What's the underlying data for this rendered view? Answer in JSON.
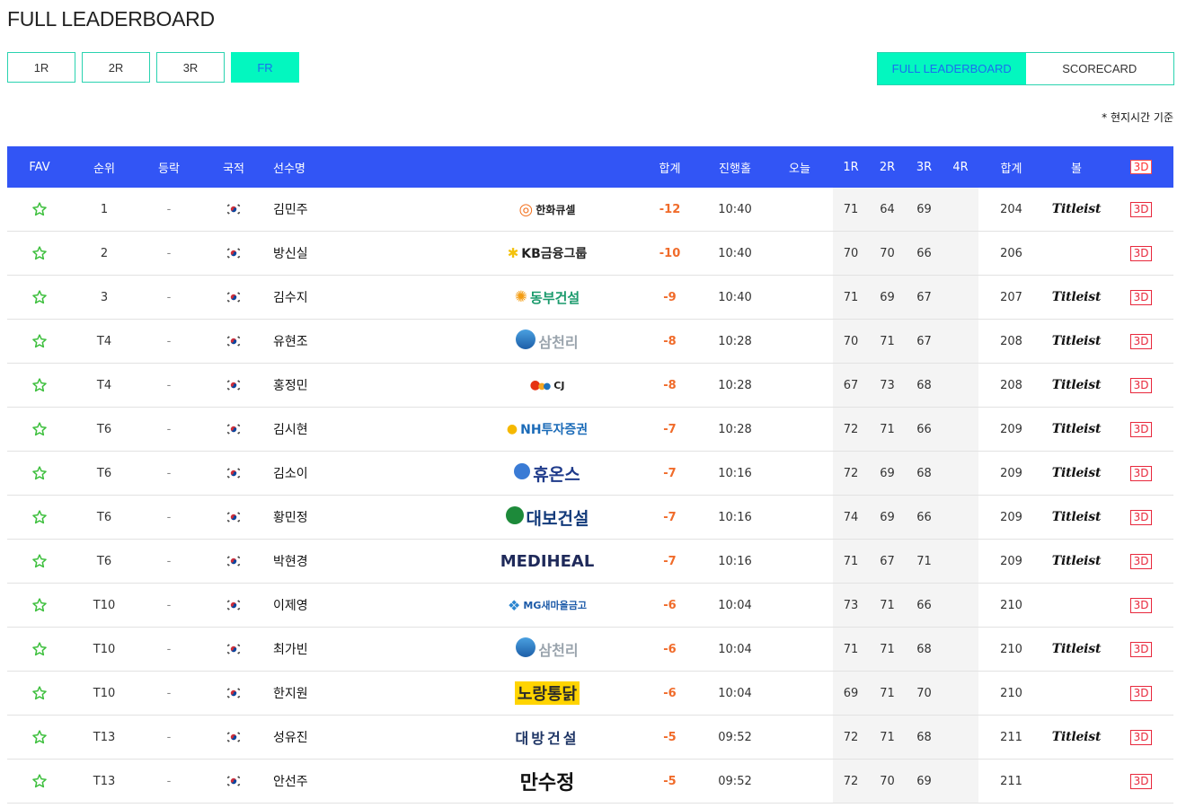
{
  "page": {
    "title": "FULL LEADERBOARD",
    "time_note": "* 현지시간 기준"
  },
  "round_tabs": [
    {
      "label": "1R",
      "active": false
    },
    {
      "label": "2R",
      "active": false
    },
    {
      "label": "3R",
      "active": false
    },
    {
      "label": "FR",
      "active": true
    }
  ],
  "view_toggle": {
    "leaderboard_label": "FULL LEADERBOARD",
    "scorecard_label": "SCORECARD"
  },
  "colors": {
    "header_blue": "#3255f5",
    "accent_mint": "#03f7bf",
    "score_orange": "#f06b2a",
    "badge_red": "#e8283c"
  },
  "table": {
    "headers": {
      "fav": "FAV",
      "rank": "순위",
      "move": "등락",
      "nation": "국적",
      "name": "선수명",
      "total_to_par": "합계",
      "hole": "진행홀",
      "today": "오늘",
      "r1": "1R",
      "r2": "2R",
      "r3": "3R",
      "r4": "4R",
      "total": "합계",
      "ball": "볼",
      "three_d": "3D"
    },
    "rows": [
      {
        "rank": "1",
        "move": "-",
        "flag": "korea-flag",
        "name": "김민주",
        "sponsor": "한화큐셀",
        "sponsor_style": "hanwha",
        "to_par": "-12",
        "hole": "10:40",
        "today": "",
        "r1": "71",
        "r2": "64",
        "r3": "69",
        "r4": "",
        "total": "204",
        "ball": "Titleist",
        "three_d": "3D"
      },
      {
        "rank": "2",
        "move": "-",
        "flag": "korea-flag",
        "name": "방신실",
        "sponsor": "KB금융그룹",
        "sponsor_style": "kb",
        "to_par": "-10",
        "hole": "10:40",
        "today": "",
        "r1": "70",
        "r2": "70",
        "r3": "66",
        "r4": "",
        "total": "206",
        "ball": "",
        "three_d": "3D"
      },
      {
        "rank": "3",
        "move": "-",
        "flag": "korea-flag",
        "name": "김수지",
        "sponsor": "동부건설",
        "sponsor_style": "dongbu",
        "to_par": "-9",
        "hole": "10:40",
        "today": "",
        "r1": "71",
        "r2": "69",
        "r3": "67",
        "r4": "",
        "total": "207",
        "ball": "Titleist",
        "three_d": "3D"
      },
      {
        "rank": "T4",
        "move": "-",
        "flag": "korea-flag",
        "name": "유현조",
        "sponsor": "삼천리",
        "sponsor_style": "samchully",
        "to_par": "-8",
        "hole": "10:28",
        "today": "",
        "r1": "70",
        "r2": "71",
        "r3": "67",
        "r4": "",
        "total": "208",
        "ball": "Titleist",
        "three_d": "3D"
      },
      {
        "rank": "T4",
        "move": "-",
        "flag": "korea-flag",
        "name": "홍정민",
        "sponsor": "CJ",
        "sponsor_style": "cj",
        "to_par": "-8",
        "hole": "10:28",
        "today": "",
        "r1": "67",
        "r2": "73",
        "r3": "68",
        "r4": "",
        "total": "208",
        "ball": "Titleist",
        "three_d": "3D"
      },
      {
        "rank": "T6",
        "move": "-",
        "flag": "korea-flag",
        "name": "김시현",
        "sponsor": "NH투자증권",
        "sponsor_style": "nh",
        "to_par": "-7",
        "hole": "10:28",
        "today": "",
        "r1": "72",
        "r2": "71",
        "r3": "66",
        "r4": "",
        "total": "209",
        "ball": "Titleist",
        "three_d": "3D"
      },
      {
        "rank": "T6",
        "move": "-",
        "flag": "korea-flag",
        "name": "김소이",
        "sponsor": "휴온스",
        "sponsor_style": "huons",
        "to_par": "-7",
        "hole": "10:16",
        "today": "",
        "r1": "72",
        "r2": "69",
        "r3": "68",
        "r4": "",
        "total": "209",
        "ball": "Titleist",
        "three_d": "3D"
      },
      {
        "rank": "T6",
        "move": "-",
        "flag": "korea-flag",
        "name": "황민정",
        "sponsor": "대보건설",
        "sponsor_style": "daebo",
        "to_par": "-7",
        "hole": "10:16",
        "today": "",
        "r1": "74",
        "r2": "69",
        "r3": "66",
        "r4": "",
        "total": "209",
        "ball": "Titleist",
        "three_d": "3D"
      },
      {
        "rank": "T6",
        "move": "-",
        "flag": "korea-flag",
        "name": "박현경",
        "sponsor": "MEDIHEAL",
        "sponsor_style": "mediheal",
        "to_par": "-7",
        "hole": "10:16",
        "today": "",
        "r1": "71",
        "r2": "67",
        "r3": "71",
        "r4": "",
        "total": "209",
        "ball": "Titleist",
        "three_d": "3D"
      },
      {
        "rank": "T10",
        "move": "-",
        "flag": "korea-flag",
        "name": "이제영",
        "sponsor": "MG새마을금고",
        "sponsor_style": "mg",
        "to_par": "-6",
        "hole": "10:04",
        "today": "",
        "r1": "73",
        "r2": "71",
        "r3": "66",
        "r4": "",
        "total": "210",
        "ball": "",
        "three_d": "3D"
      },
      {
        "rank": "T10",
        "move": "-",
        "flag": "korea-flag",
        "name": "최가빈",
        "sponsor": "삼천리",
        "sponsor_style": "samchully",
        "to_par": "-6",
        "hole": "10:04",
        "today": "",
        "r1": "71",
        "r2": "71",
        "r3": "68",
        "r4": "",
        "total": "210",
        "ball": "Titleist",
        "three_d": "3D"
      },
      {
        "rank": "T10",
        "move": "-",
        "flag": "korea-flag",
        "name": "한지원",
        "sponsor": "노랑통닭",
        "sponsor_style": "norang",
        "to_par": "-6",
        "hole": "10:04",
        "today": "",
        "r1": "69",
        "r2": "71",
        "r3": "70",
        "r4": "",
        "total": "210",
        "ball": "",
        "three_d": "3D"
      },
      {
        "rank": "T13",
        "move": "-",
        "flag": "korea-flag",
        "name": "성유진",
        "sponsor": "대방건설",
        "sponsor_style": "daebang",
        "to_par": "-5",
        "hole": "09:52",
        "today": "",
        "r1": "72",
        "r2": "71",
        "r3": "68",
        "r4": "",
        "total": "211",
        "ball": "Titleist",
        "three_d": "3D"
      },
      {
        "rank": "T13",
        "move": "-",
        "flag": "korea-flag",
        "name": "안선주",
        "sponsor": "만수정",
        "sponsor_style": "mansujeong",
        "to_par": "-5",
        "hole": "09:52",
        "today": "",
        "r1": "72",
        "r2": "70",
        "r3": "69",
        "r4": "",
        "total": "211",
        "ball": "",
        "three_d": "3D"
      }
    ]
  }
}
